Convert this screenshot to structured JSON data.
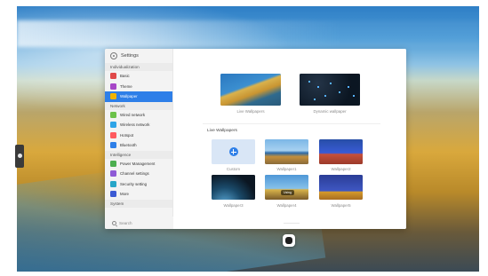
{
  "app": {
    "title": "Settings"
  },
  "sidebar": {
    "sections": [
      {
        "label": "Individualization",
        "items": [
          {
            "label": "Basic",
            "icon": "basic-icon",
            "color": "#e04848",
            "active": false
          },
          {
            "label": "Theme",
            "icon": "theme-icon",
            "color": "#a646c7",
            "active": false
          },
          {
            "label": "Wallpaper",
            "icon": "wallpaper-icon",
            "color": "#f2b400",
            "active": true
          }
        ]
      },
      {
        "label": "Network",
        "items": [
          {
            "label": "Wired network",
            "icon": "wired-network-icon",
            "color": "#6cc24a",
            "active": false
          },
          {
            "label": "Wireless network",
            "icon": "wireless-network-icon",
            "color": "#2fa4e7",
            "active": false
          },
          {
            "label": "Hotspot",
            "icon": "hotspot-icon",
            "color": "#ff5a5f",
            "active": false
          },
          {
            "label": "Bluetooth",
            "icon": "bluetooth-icon",
            "color": "#2e7fe8",
            "active": false
          }
        ]
      },
      {
        "label": "Intelligence",
        "items": [
          {
            "label": "Power Management",
            "icon": "power-management-icon",
            "color": "#4caf50",
            "active": false
          },
          {
            "label": "Channel settings",
            "icon": "channel-settings-icon",
            "color": "#8e5bd6",
            "active": false
          },
          {
            "label": "Security setting",
            "icon": "security-setting-icon",
            "color": "#27a6c8",
            "active": false
          },
          {
            "label": "More",
            "icon": "more-icon",
            "color": "#3c5bd4",
            "active": false
          }
        ]
      },
      {
        "label": "System",
        "items": []
      }
    ],
    "search_placeholder": "Search"
  },
  "wallpaper": {
    "top_options": [
      {
        "label": "Live Wallpapers"
      },
      {
        "label": "Dynamic wallpaper"
      }
    ],
    "section_title": "Live Wallpapers",
    "tiles": [
      {
        "label": "Custom",
        "kind": "custom"
      },
      {
        "label": "Wallpaper1",
        "kind": "w1"
      },
      {
        "label": "Wallpaper2",
        "kind": "w2"
      },
      {
        "label": "Wallpaper3",
        "kind": "w3"
      },
      {
        "label": "Wallpaper4",
        "kind": "w4",
        "badge": "Using"
      },
      {
        "label": "Wallpaper5",
        "kind": "w5"
      }
    ]
  }
}
